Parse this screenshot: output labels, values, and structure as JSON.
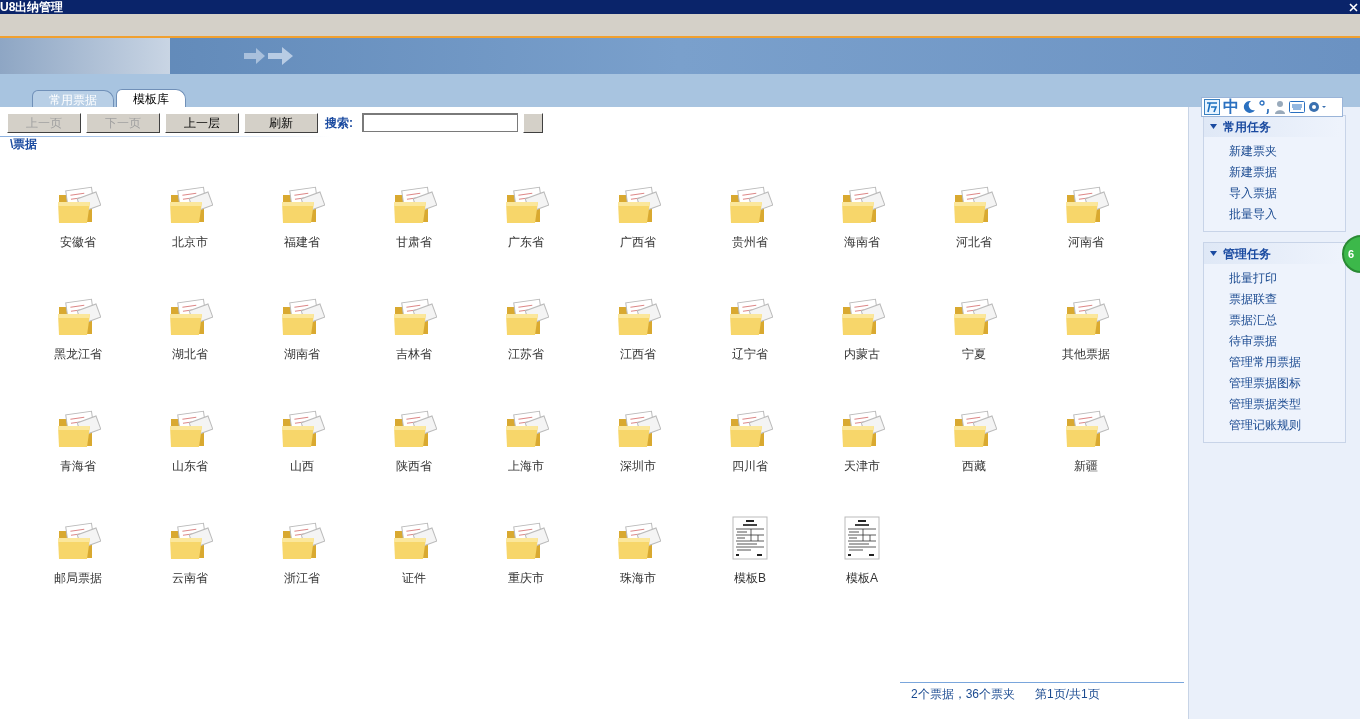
{
  "window": {
    "title": "U8出纳管理"
  },
  "tabs": [
    {
      "label": "常用票据",
      "selected": false
    },
    {
      "label": "模板库",
      "selected": true
    }
  ],
  "toolbar": {
    "buttons": [
      {
        "label": "上一页",
        "disabled": true
      },
      {
        "label": "下一页",
        "disabled": true
      },
      {
        "label": "上一层",
        "disabled": false
      },
      {
        "label": "刷新",
        "disabled": false
      }
    ],
    "search_label": "搜索:"
  },
  "path": "\\票据",
  "items": [
    {
      "kind": "folder",
      "label": "安徽省"
    },
    {
      "kind": "folder",
      "label": "北京市"
    },
    {
      "kind": "folder",
      "label": "福建省"
    },
    {
      "kind": "folder",
      "label": "甘肃省"
    },
    {
      "kind": "folder",
      "label": "广东省"
    },
    {
      "kind": "folder",
      "label": "广西省"
    },
    {
      "kind": "folder",
      "label": "贵州省"
    },
    {
      "kind": "folder",
      "label": "海南省"
    },
    {
      "kind": "folder",
      "label": "河北省"
    },
    {
      "kind": "folder",
      "label": "河南省"
    },
    {
      "kind": "folder",
      "label": "黑龙江省"
    },
    {
      "kind": "folder",
      "label": "湖北省"
    },
    {
      "kind": "folder",
      "label": "湖南省"
    },
    {
      "kind": "folder",
      "label": "吉林省"
    },
    {
      "kind": "folder",
      "label": "江苏省"
    },
    {
      "kind": "folder",
      "label": "江西省"
    },
    {
      "kind": "folder",
      "label": "辽宁省"
    },
    {
      "kind": "folder",
      "label": "内蒙古"
    },
    {
      "kind": "folder",
      "label": "宁夏"
    },
    {
      "kind": "folder",
      "label": "其他票据"
    },
    {
      "kind": "folder",
      "label": "青海省"
    },
    {
      "kind": "folder",
      "label": "山东省"
    },
    {
      "kind": "folder",
      "label": "山西"
    },
    {
      "kind": "folder",
      "label": "陕西省"
    },
    {
      "kind": "folder",
      "label": "上海市"
    },
    {
      "kind": "folder",
      "label": "深圳市"
    },
    {
      "kind": "folder",
      "label": "四川省"
    },
    {
      "kind": "folder",
      "label": "天津市"
    },
    {
      "kind": "folder",
      "label": "西藏"
    },
    {
      "kind": "folder",
      "label": "新疆"
    },
    {
      "kind": "folder",
      "label": "邮局票据"
    },
    {
      "kind": "folder",
      "label": "云南省"
    },
    {
      "kind": "folder",
      "label": "浙江省"
    },
    {
      "kind": "folder",
      "label": "证件"
    },
    {
      "kind": "folder",
      "label": "重庆市"
    },
    {
      "kind": "folder",
      "label": "珠海市"
    },
    {
      "kind": "template",
      "label": "模板B"
    },
    {
      "kind": "template",
      "label": "模板A"
    }
  ],
  "status": {
    "count": "2个票据，36个票夹",
    "page": "第1页/共1页"
  },
  "ime_toolbar": {
    "mode": "中"
  },
  "task_panels": [
    {
      "title": "常用任务",
      "expanded": true,
      "items": [
        "新建票夹",
        "新建票据",
        "导入票据",
        "批量导入"
      ]
    },
    {
      "title": "管理任务",
      "expanded": true,
      "items": [
        "批量打印",
        "票据联查",
        "票据汇总",
        "待审票据",
        "管理常用票据",
        "管理票据图标",
        "管理票据类型",
        "管理记账规则"
      ]
    }
  ],
  "floating_badge": "6"
}
